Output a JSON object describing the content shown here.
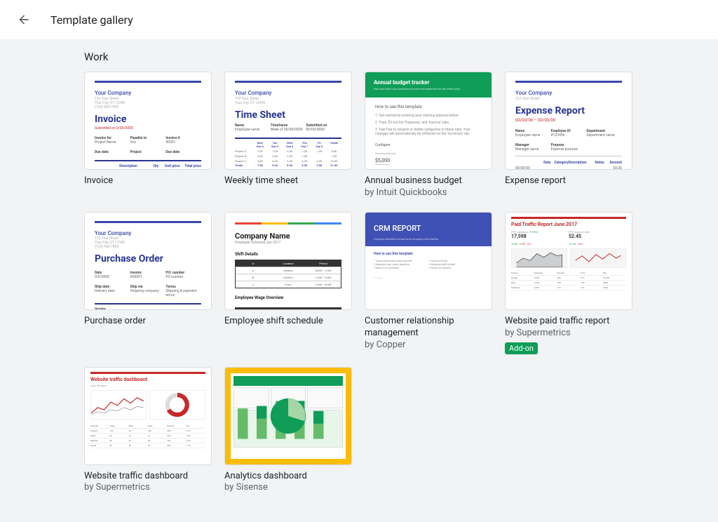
{
  "header": {
    "title": "Template gallery"
  },
  "section": {
    "title": "Work"
  },
  "templates": [
    {
      "title": "Invoice",
      "byline": "",
      "preview": {
        "company": "Your Company",
        "heading": "Invoice",
        "subline": "Submitted on 0/00/0000"
      }
    },
    {
      "title": "Weekly time sheet",
      "byline": "",
      "preview": {
        "company": "Your Company",
        "heading": "Time Sheet"
      }
    },
    {
      "title": "Annual business budget",
      "byline": "by Intuit Quickbooks",
      "preview": {
        "heading": "Annual budget tracker",
        "how": "How to use this template",
        "config": "Configure",
        "amount": "$5,000"
      }
    },
    {
      "title": "Expense report",
      "byline": "",
      "preview": {
        "company": "Your Company",
        "heading": "Expense Report",
        "subline": "00/00/00 – 00/00/00"
      }
    },
    {
      "title": "Purchase order",
      "byline": "",
      "preview": {
        "company": "Your Company",
        "heading": "Purchase Order"
      }
    },
    {
      "title": "Employee shift schedule",
      "byline": "",
      "preview": {
        "heading": "Company Name",
        "sub": "Employee Schedule Jan 2017"
      }
    },
    {
      "title": "Customer relationship management",
      "byline": "by Copper",
      "preview": {
        "heading": "CRM REPORT",
        "how": "How to use this template"
      }
    },
    {
      "title": "Website paid traffic report",
      "byline": "by Supermetrics",
      "badge": "Add-on",
      "preview": {
        "heading": "Paid Traffic Report June 2017",
        "big1": "17,598",
        "big2": "52.45"
      }
    },
    {
      "title": "Website traffic dashboard",
      "byline": "by Supermetrics",
      "preview": {
        "heading": "Website traffic dashboard"
      }
    },
    {
      "title": "Analytics dashboard",
      "byline": "by Sisense",
      "preview": {}
    }
  ]
}
